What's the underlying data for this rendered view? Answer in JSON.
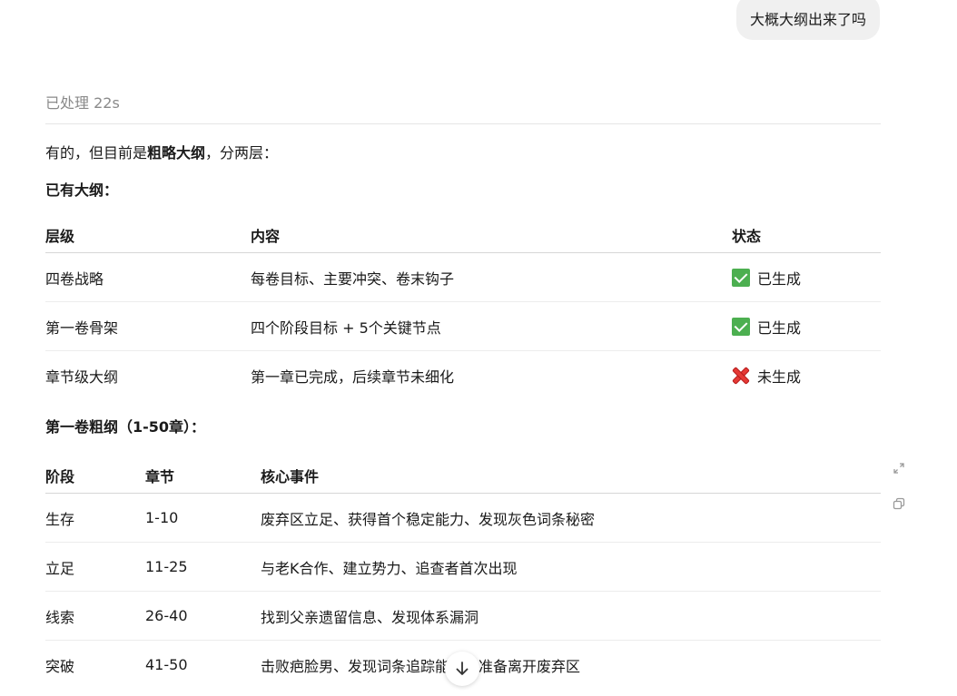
{
  "user_message": "大概大纲出来了吗",
  "thinking_status": "已处理 22s",
  "intro": {
    "prefix": "有的，但目前是",
    "bold": "粗略大纲",
    "suffix": "，分两层："
  },
  "section1": {
    "heading": "已有大纲：",
    "columns": [
      "层级",
      "内容",
      "状态"
    ],
    "rows": [
      {
        "level": "四卷战略",
        "content": "每卷目标、主要冲突、卷末钩子",
        "status": "已生成",
        "icon": "check-icon"
      },
      {
        "level": "第一卷骨架",
        "content": "四个阶段目标 + 5个关键节点",
        "status": "已生成",
        "icon": "check-icon"
      },
      {
        "level": "章节级大纲",
        "content": "第一章已完成，后续章节未细化",
        "status": "未生成",
        "icon": "cross-icon"
      }
    ]
  },
  "section2": {
    "heading": "第一卷粗纲（1-50章）：",
    "columns": [
      "阶段",
      "章节",
      "核心事件"
    ],
    "rows": [
      {
        "stage": "生存",
        "chapters": "1-10",
        "event": "废弃区立足、获得首个稳定能力、发现灰色词条秘密"
      },
      {
        "stage": "立足",
        "chapters": "11-25",
        "event": "与老K合作、建立势力、追查者首次出现"
      },
      {
        "stage": "线索",
        "chapters": "26-40",
        "event": "找到父亲遗留信息、发现体系漏洞"
      },
      {
        "stage": "突破",
        "chapters": "41-50",
        "event": "击败疤脸男、发现词条追踪能力、准备离开废弃区"
      }
    ]
  },
  "colors": {
    "check": "#4caf50",
    "cross": "#e53935",
    "bubble": "#f0f0f0",
    "muted": "#8a8a8a"
  }
}
